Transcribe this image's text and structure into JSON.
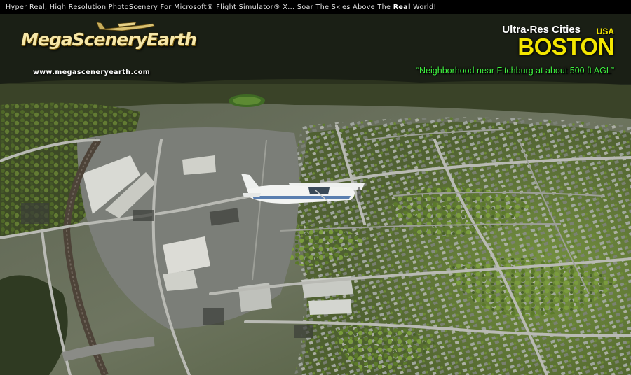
{
  "banner": {
    "tagline_pre": "Hyper Real, High Resolution PhotoScenery For Microsoft® Flight Simulator® X... Soar The Skies Above The ",
    "tagline_bold": "Real",
    "tagline_post": " World!"
  },
  "brand": {
    "logo_text": "MegaSceneryEarth",
    "website": "www.megasceneryearth.com"
  },
  "product": {
    "series": "Ultra-Res Cities",
    "country": "USA",
    "city": "BOSTON",
    "caption": "“Neighborhood near Fitchburg at about 500 ft AGL”"
  },
  "colors": {
    "city_yellow": "#f3e600",
    "caption_green": "#3ef03e",
    "logo_gold": "#f6e7a8",
    "forest_dark": "#2f3a22",
    "foliage_green": "#6e8f3a",
    "roof_gray": "#9aa0a4"
  },
  "icons": {
    "logo_plane": "airplane-silhouette",
    "aircraft": "cessna-high-wing-aircraft"
  }
}
